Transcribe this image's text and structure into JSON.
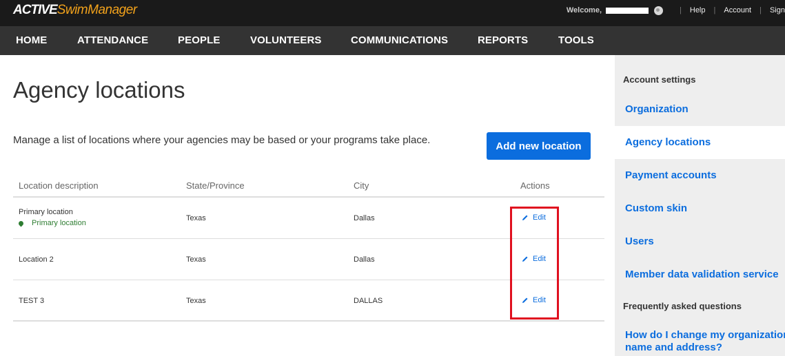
{
  "topbar": {
    "logo_brand": "ACTIVE",
    "logo_product": "SwimManager",
    "welcome": "Welcome,",
    "help": "Help",
    "account": "Account",
    "sign": "Sign"
  },
  "nav": {
    "items": [
      "HOME",
      "ATTENDANCE",
      "PEOPLE",
      "VOLUNTEERS",
      "COMMUNICATIONS",
      "REPORTS",
      "TOOLS"
    ]
  },
  "main": {
    "title": "Agency locations",
    "intro": "Manage a list of locations where your agencies may be based or your programs take place.",
    "add_button": "Add new location",
    "table": {
      "headers": [
        "Location description",
        "State/Province",
        "City",
        "Actions"
      ],
      "rows": [
        {
          "description": "Primary location",
          "tag": "Primary location",
          "state": "Texas",
          "city": "Dallas",
          "action": "Edit"
        },
        {
          "description": "Location 2",
          "state": "Texas",
          "city": "Dallas",
          "action": "Edit"
        },
        {
          "description": "TEST 3",
          "state": "Texas",
          "city": "DALLAS",
          "action": "Edit"
        }
      ]
    }
  },
  "sidebar": {
    "heading": "Account settings",
    "items": [
      "Organization",
      "Agency locations",
      "Payment accounts",
      "Custom skin",
      "Users",
      "Member data validation service"
    ],
    "faq_heading": "Frequently asked questions",
    "faq_item": "How do I change my organization name and address?"
  },
  "colors": {
    "accent": "#0b6dde",
    "highlight": "#e0101f",
    "primary_tag": "#2e7d32"
  }
}
